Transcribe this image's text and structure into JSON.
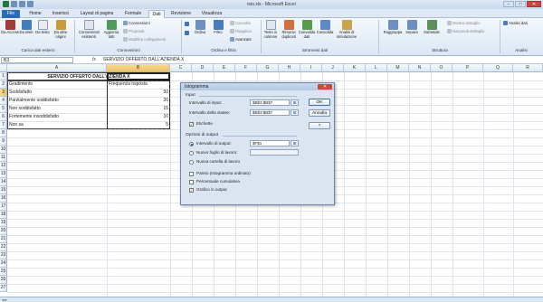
{
  "window": {
    "title": "isto.xls - Microsoft Excel",
    "minimize": "−",
    "maximize": "□",
    "close": "✕"
  },
  "ribbon_tabs": [
    "File",
    "Home",
    "Inserisci",
    "Layout di pagina",
    "Formule",
    "Dati",
    "Revisione",
    "Visualizza"
  ],
  "ribbon_active_tab": "Dati",
  "ribbon": {
    "get_data": {
      "da_access": "Da Access",
      "da_web": "Da Web",
      "da_testo": "Da testo",
      "da_altre_origini": "Da altre origini",
      "group_label": "Carica dati esterni"
    },
    "connections": {
      "connessioni_esistenti": "Connessioni esistenti",
      "aggiorna_tutti": "Aggiorna tutti",
      "connessioni": "Connessioni",
      "proprieta": "Proprietà",
      "modifica_collegamenti": "Modifica collegamenti",
      "group_label": "Connessioni"
    },
    "sort_filter": {
      "ordina": "Ordina",
      "filtro": "Filtro",
      "cancella": "Cancella",
      "riapplica": "Riapplica",
      "avanzate": "Avanzate",
      "group_label": "Ordina e filtra"
    },
    "data_tools": {
      "testo_in_colonne": "Testo in colonne",
      "rimuovi_duplicati": "Rimuovi duplicati",
      "convalida_dati": "Convalida dati",
      "consolida": "Consolida",
      "analisi_simulazione": "Analisi di simulazione",
      "group_label": "Strumenti dati"
    },
    "outline": {
      "raggruppa": "Raggruppa",
      "separa": "Separa",
      "subtotale": "Subtotale",
      "mostra_dettaglio": "Mostra dettaglio",
      "nascondi_dettaglio": "Nascondi dettaglio",
      "group_label": "Struttura"
    },
    "analysis": {
      "analisi_dati": "Analisi dati",
      "group_label": "Analisi"
    }
  },
  "formula_bar": {
    "name_box": "B3",
    "fx": "fx",
    "content": "SERVIZIO OFFERTO DALL'AZIENDA X"
  },
  "columns": [
    "A",
    "B",
    "C",
    "D",
    "E",
    "F",
    "G",
    "H",
    "I",
    "J",
    "K",
    "L",
    "M",
    "N",
    "O",
    "P",
    "Q",
    "R"
  ],
  "rows": [
    "1",
    "2",
    "3",
    "4",
    "5",
    "6",
    "7",
    "8",
    "9",
    "10",
    "11",
    "12",
    "13",
    "14",
    "15",
    "16",
    "17",
    "18",
    "19",
    "20",
    "21",
    "22",
    "23",
    "24",
    "25",
    "26",
    "27"
  ],
  "sheet": {
    "title": "SERVIZIO OFFERTO DALL'AZIENDA X",
    "headers": [
      "Gradimento",
      "Frequenza risposta"
    ],
    "table": [
      {
        "label": "Soddisfatto",
        "value": "50"
      },
      {
        "label": "Parzialmente soddisfatto",
        "value": "20"
      },
      {
        "label": "Non soddisfatto",
        "value": "15"
      },
      {
        "label": "Fortemente insoddisfatto",
        "value": "10"
      },
      {
        "label": "Non sa",
        "value": "5"
      }
    ]
  },
  "sheet_tabs": {
    "nav": "◂ ▸"
  },
  "dialog": {
    "title": "Istogramma",
    "close": "✕",
    "input_section": "Input",
    "input_range_label": "Intervallo di input:",
    "input_range_value": "$B$3:$B$7",
    "bin_range_label": "Intervallo della classe:",
    "bin_range_value": "$B$3:$B$7",
    "ref_button": "⊞",
    "labels_checkbox": "Etichette",
    "output_section": "Opzioni di output",
    "output_range_label": "Intervallo di output:",
    "output_range_value": "$F$1",
    "new_sheet_label": "Nuovo foglio di lavoro:",
    "new_workbook_label": "Nuova cartella di lavoro",
    "pareto_label": "Pareto (istogramma ordinato)",
    "cumulative_label": "Percentuale cumulativa",
    "chart_output_label": "Grafico in output",
    "ok": "OK",
    "cancel": "Annulla",
    "help": "?",
    "check_mark": "✓"
  }
}
